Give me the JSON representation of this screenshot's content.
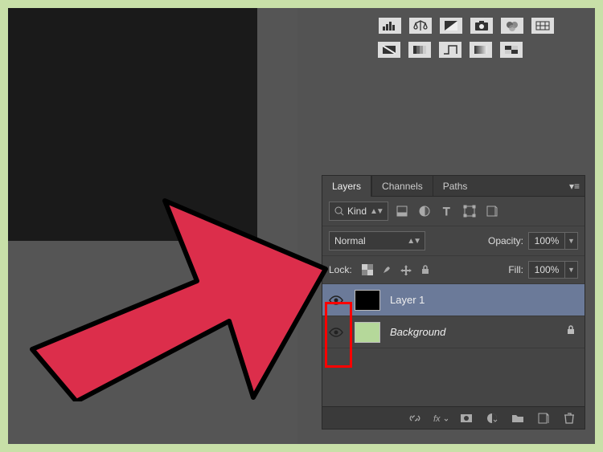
{
  "tabs": {
    "layers": "Layers",
    "channels": "Channels",
    "paths": "Paths"
  },
  "filter": {
    "kind": "Kind"
  },
  "blend": {
    "mode": "Normal",
    "opacity_label": "Opacity:",
    "opacity_value": "100%"
  },
  "lock": {
    "label": "Lock:",
    "fill_label": "Fill:",
    "fill_value": "100%"
  },
  "layers": [
    {
      "name": "Layer 1",
      "selected": true,
      "locked": false,
      "thumb": "black"
    },
    {
      "name": "Background",
      "selected": false,
      "locked": true,
      "thumb": "green",
      "italic": true
    }
  ]
}
